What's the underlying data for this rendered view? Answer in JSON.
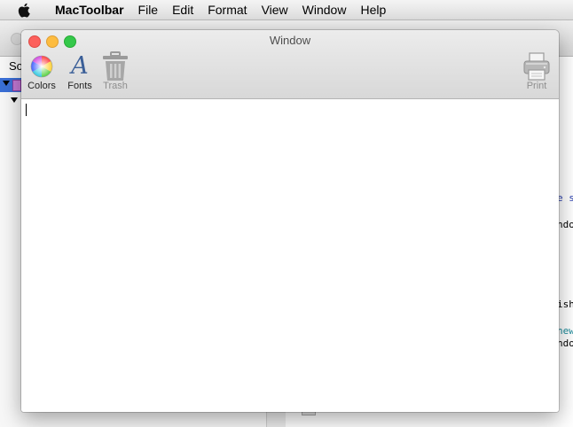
{
  "menubar": {
    "app_name": "MacToolbar",
    "items": [
      "File",
      "Edit",
      "Format",
      "View",
      "Window",
      "Help"
    ]
  },
  "background_window": {
    "nav_tab": "So",
    "code_fragments": [
      "e s",
      "ndo",
      "ish",
      "new",
      "ndo"
    ]
  },
  "window": {
    "title": "Window",
    "toolbar": {
      "colors_label": "Colors",
      "fonts_label": "Fonts",
      "fonts_glyph": "A",
      "trash_label": "Trash",
      "print_label": "Print"
    },
    "text_content": ""
  },
  "colors": {
    "close": "#fc605c",
    "minimize": "#fdbc40",
    "zoom": "#34c84a",
    "fonts_icon": "#3b5f98",
    "disabled_text": "#8e8e8e"
  },
  "icons": [
    "apple-icon",
    "color-wheel-icon",
    "fonts-icon",
    "trash-icon",
    "printer-icon"
  ]
}
